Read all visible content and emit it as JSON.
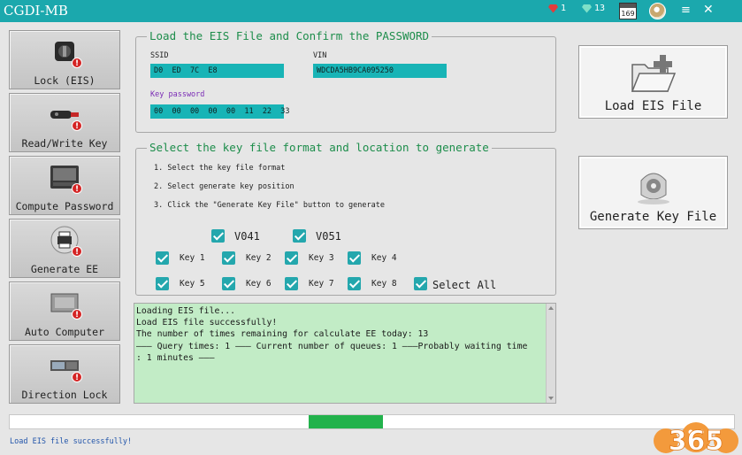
{
  "window": {
    "title": "CGDI-MB"
  },
  "titlebar": {
    "ruby_count": "1",
    "gem_count": "13",
    "calendar_day": "169",
    "menu_glyph": "≡",
    "close_glyph": "✕"
  },
  "sidebar": {
    "items": [
      {
        "label": "Lock (EIS)",
        "icon": "ignition-lock-icon"
      },
      {
        "label": "Read/Write Key",
        "icon": "car-key-icon"
      },
      {
        "label": "Compute Password",
        "icon": "keyboard-icon"
      },
      {
        "label": "Generate EE",
        "icon": "printer-icon"
      },
      {
        "label": "Auto Computer",
        "icon": "ecu-icon"
      },
      {
        "label": "Direction Lock",
        "icon": "steering-lock-icon"
      }
    ],
    "badge": "!"
  },
  "eis_group": {
    "title": "Load the EIS File and Confirm the PASSWORD",
    "ssid_label": "SSID",
    "ssid_value": "D0  ED  7C  E8",
    "vin_label": "VIN",
    "vin_value": "WDCDA5HB9CA095250",
    "key_password_label": "Key password",
    "key_password_value": "00  00  00  00  00  11  22  33"
  },
  "keyfile_group": {
    "title": "Select the key file format and location to generate",
    "steps": [
      "1. Select the key file format",
      "2. Select generate key position",
      "3. Click the \"Generate Key File\" button to generate"
    ],
    "formats": [
      "V041",
      "V051"
    ],
    "keys": [
      "Key 1",
      "Key 2",
      "Key 3",
      "Key 4",
      "Key 5",
      "Key 6",
      "Key 7",
      "Key 8"
    ],
    "select_all": "Select All"
  },
  "log": {
    "text": "Loading EIS file...\nLoad EIS file successfully!\nThe number of times remaining for calculate EE today: 13\n——— Query times: 1 ——— Current number of queues: 1 ———Probably waiting time\n: 1 minutes ———"
  },
  "buttons": {
    "load_eis": "Load EIS File",
    "generate_key": "Generate Key File"
  },
  "status": {
    "text": "Load EIS file successfully!"
  },
  "logo": {
    "text": "365"
  },
  "colors": {
    "accent": "#1ba8ad",
    "field": "#18b4b6",
    "legend": "#1d8d4b",
    "log_bg": "#c2ecc6",
    "progress": "#22b24c"
  }
}
